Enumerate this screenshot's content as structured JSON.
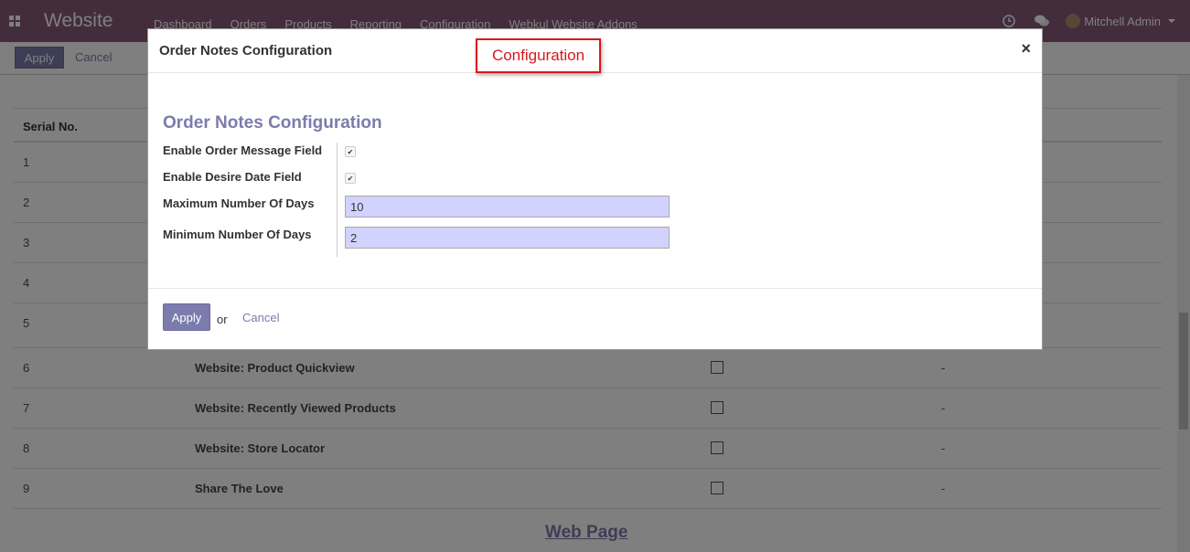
{
  "navbar": {
    "app_name": "Website",
    "menu": [
      "Dashboard",
      "Orders",
      "Products",
      "Reporting",
      "Configuration",
      "Webkul Website Addons"
    ],
    "user_name": "Mitchell Admin",
    "icons": [
      "apps-icon",
      "clock-icon",
      "chat-icon",
      "chevron-down-icon"
    ]
  },
  "control_panel": {
    "apply_label": "Apply",
    "cancel_label": "Cancel"
  },
  "background_table": {
    "header": "Serial No.",
    "rows": [
      {
        "sn": "1",
        "name": ""
      },
      {
        "sn": "2",
        "name": ""
      },
      {
        "sn": "3",
        "name": ""
      },
      {
        "sn": "4",
        "name": ""
      },
      {
        "sn": "5",
        "name": ""
      },
      {
        "sn": "6",
        "name": "Website: Product Quickview",
        "dash": "-"
      },
      {
        "sn": "7",
        "name": "Website: Recently Viewed Products",
        "dash": "-"
      },
      {
        "sn": "8",
        "name": "Website: Store Locator",
        "dash": "-"
      },
      {
        "sn": "9",
        "name": "Share The Love",
        "dash": "-"
      }
    ],
    "footer_link": "Web Page"
  },
  "modal": {
    "title": "Order Notes Configuration",
    "callout": "Configuration",
    "close": "×",
    "form_title": "Order Notes Configuration",
    "fields": {
      "enable_message_label": "Enable Order Message Field",
      "enable_message_checked": true,
      "enable_date_label": "Enable Desire Date Field",
      "enable_date_checked": true,
      "max_days_label": "Maximum Number Of Days",
      "max_days_value": "10",
      "min_days_label": "Minimum Number Of Days",
      "min_days_value": "2"
    },
    "footer": {
      "apply_label": "Apply",
      "or_text": "or",
      "cancel_label": "Cancel"
    }
  },
  "colors": {
    "brand": "#875a7b",
    "accent": "#7c7bad",
    "callout": "#d9171e",
    "input_bg": "#d2d2ff"
  }
}
